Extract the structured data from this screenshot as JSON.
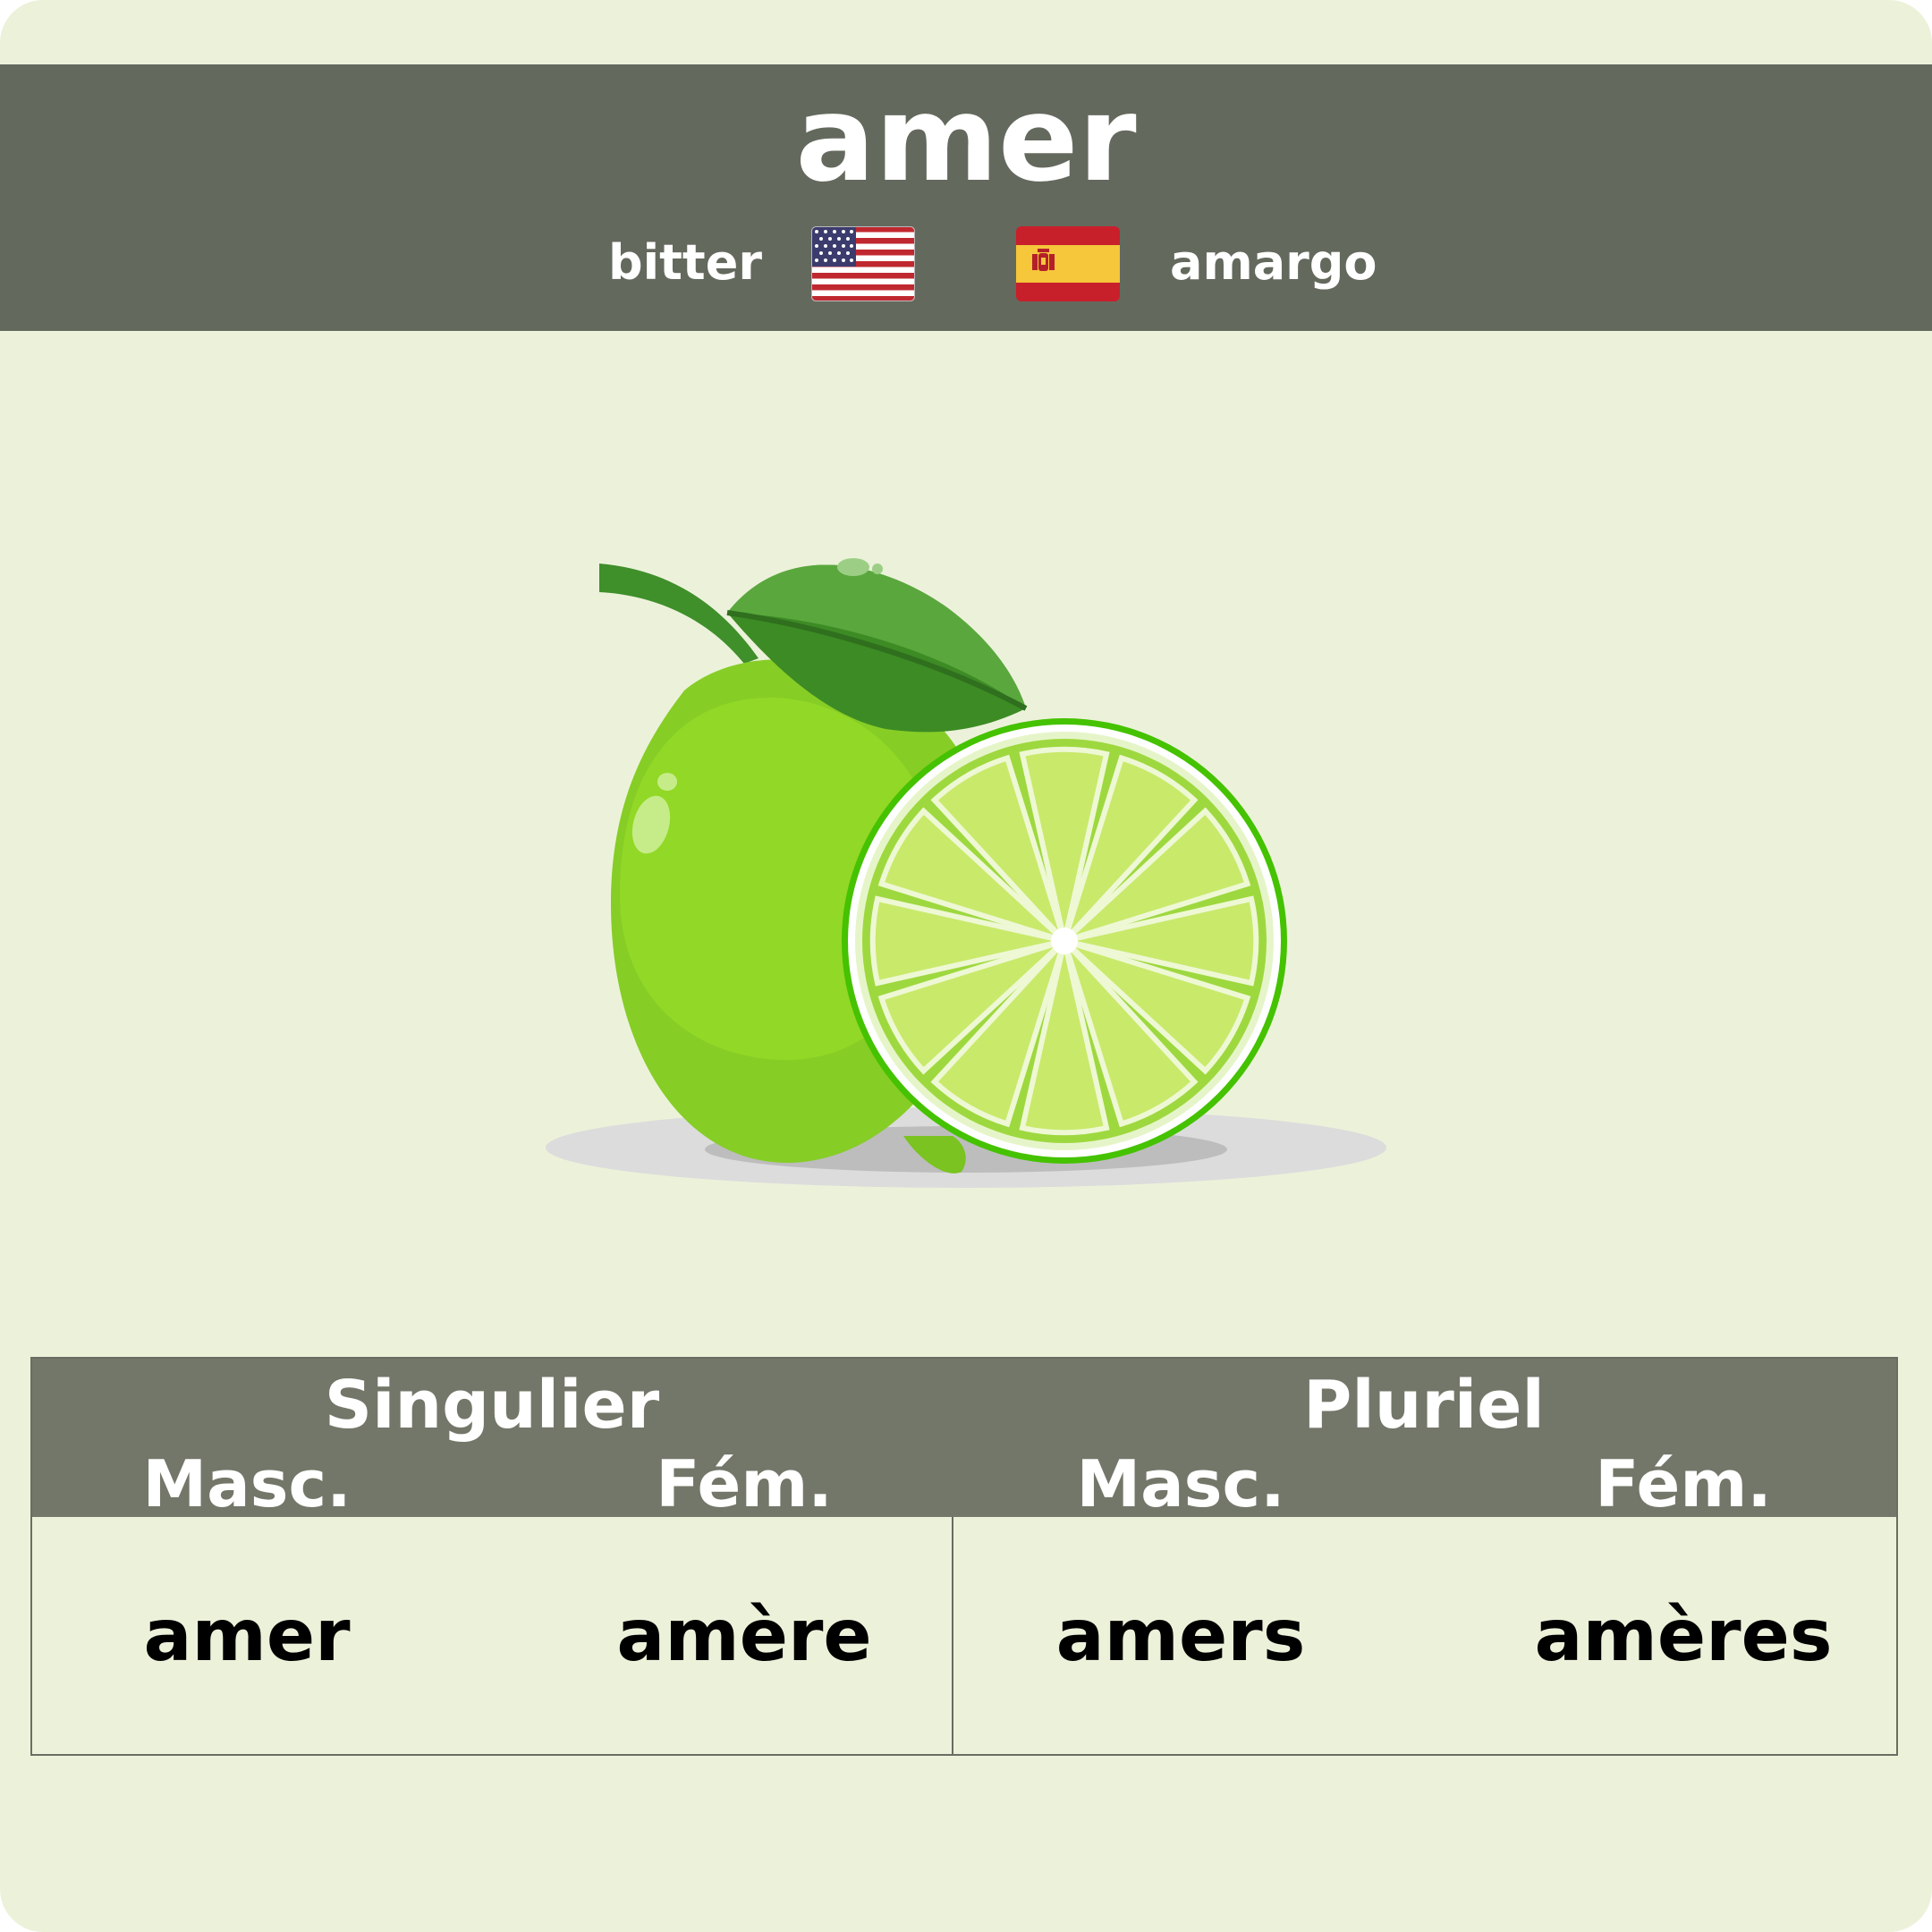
{
  "card": {
    "word": "amer",
    "translations": {
      "english": "bitter",
      "spanish": "amargo"
    },
    "flags": [
      "us-flag-icon",
      "spain-flag-icon"
    ],
    "illustration": "lime-icon"
  },
  "table": {
    "groups": [
      "Singulier",
      "Pluriel"
    ],
    "subheaders": [
      "Masc.",
      "Fém.",
      "Masc.",
      "Fém."
    ],
    "forms": [
      "amer",
      "amère",
      "amers",
      "amères"
    ]
  },
  "colors": {
    "background": "#ecf2da",
    "header": "#64695e",
    "table_header": "#737769",
    "lime": "#8ed627"
  }
}
